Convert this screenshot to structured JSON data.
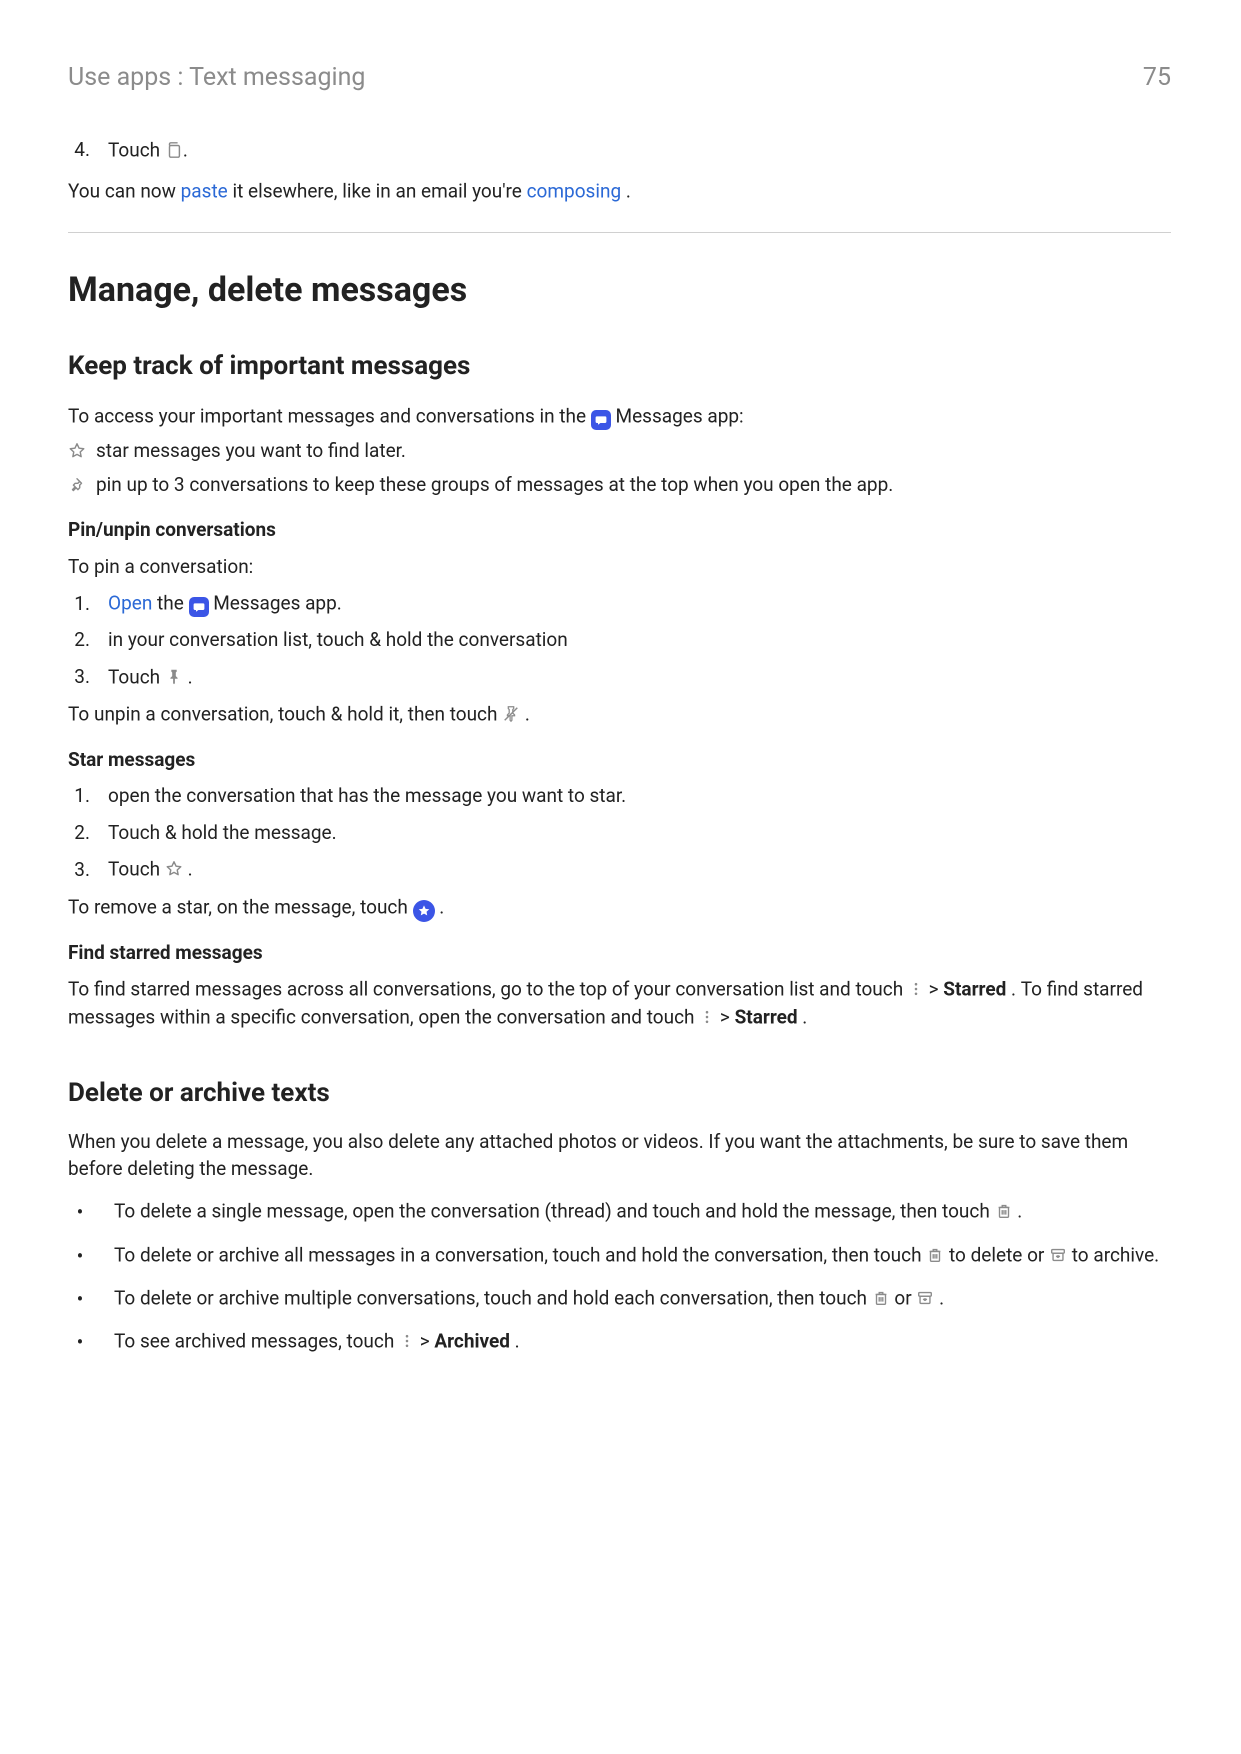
{
  "header": {
    "breadcrumb": "Use apps : Text messaging",
    "page_number": "75"
  },
  "top": {
    "step4_num": "4.",
    "step4_text": "Touch ",
    "p1_a": "You can now ",
    "p1_paste": "paste",
    "p1_b": " it elsewhere, like in an email you're ",
    "p1_compose": "composing",
    "p1_c": "."
  },
  "h1": "Manage, delete messages",
  "keep": {
    "h2": "Keep track of important messages",
    "intro_a": "To access your important messages and conversations in the ",
    "intro_b": " Messages app:",
    "star_line": "star messages you want to find later.",
    "pin_line": "pin up to 3 conversations to keep these groups of messages at the top when you open the app.",
    "pin_h3": "Pin/unpin conversations",
    "pin_intro": "To pin a conversation:",
    "pin_steps": {
      "n1": "1.",
      "s1_open": "Open",
      "s1_b": " the ",
      "s1_c": " Messages app.",
      "n2": "2.",
      "s2": "in your conversation list, touch & hold the conversation",
      "n3": "3.",
      "s3_a": "Touch ",
      "s3_b": "."
    },
    "unpin_a": "To unpin a conversation, touch & hold it, then touch ",
    "unpin_b": ".",
    "star_h3": "Star messages",
    "star_steps": {
      "n1": "1.",
      "s1": "open the conversation that has the message you want to star.",
      "n2": "2.",
      "s2": "Touch & hold the message.",
      "n3": "3.",
      "s3_a": "Touch ",
      "s3_b": "."
    },
    "remove_a": "To remove a star, on the message, touch ",
    "remove_b": ".",
    "find_h3": "Find starred messages",
    "find1_a": "To find starred messages across all conversations, go to the top of your conversation list and touch ",
    "find1_b": " > ",
    "find1_starred": "Starred",
    "find1_c": ".",
    "find2_a": "To find starred messages within a specific conversation, open the conversation and touch ",
    "find2_b": " > ",
    "find2_starred": "Starred",
    "find2_c": "."
  },
  "delete": {
    "h2": "Delete or archive texts",
    "intro": "When you delete a message, you also delete any attached photos or videos. If you want the attachments, be sure to save them before deleting the message.",
    "b1_a": "To delete a single message, open the conversation (thread) and touch and hold the message, then touch ",
    "b1_b": ".",
    "b2_a": "To delete or archive all messages in a conversation, touch and hold the conversation, then touch ",
    "b2_b": " to delete or ",
    "b2_c": " to archive.",
    "b3_a": "To delete or archive multiple conversations, touch and hold each conversation, then touch ",
    "b3_b": " or ",
    "b3_c": ".",
    "b4_a": "To see archived messages, touch ",
    "b4_b": " > ",
    "b4_archived": "Archived",
    "b4_c": "."
  }
}
